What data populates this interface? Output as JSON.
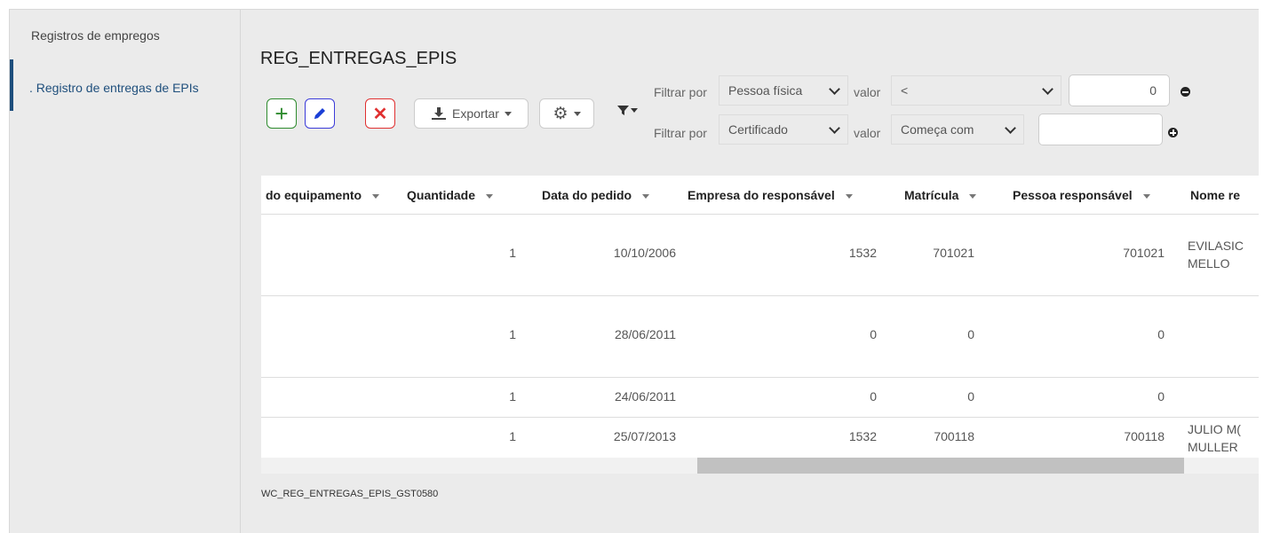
{
  "sidebar": {
    "items": [
      {
        "label": "Registros de empregos"
      },
      {
        "label": ". Registro de entregas de EPIs"
      }
    ]
  },
  "page": {
    "title": "REG_ENTREGAS_EPIS",
    "footer_id": "WC_REG_ENTREGAS_EPIS_GST0580"
  },
  "toolbar": {
    "add_icon": "plus-icon",
    "edit_icon": "pencil-icon",
    "delete_icon": "x-icon",
    "export_label": "Exportar",
    "settings_icon": "gear-icon",
    "filter_icon": "funnel-icon"
  },
  "filters": [
    {
      "label": "Filtrar por",
      "field": "Pessoa física",
      "value_label": "valor",
      "operator": "<",
      "value": "0",
      "action": "remove"
    },
    {
      "label": "Filtrar por",
      "field": "Certificado",
      "value_label": "valor",
      "operator": "Começa com",
      "value": "",
      "action": "add"
    }
  ],
  "table": {
    "columns": [
      "do equipamento",
      "Quantidade",
      "Data do pedido",
      "Empresa do responsável",
      "Matrícula",
      "Pessoa responsável",
      "Nome re"
    ],
    "rows": [
      {
        "equip": "",
        "qtd": "1",
        "data": "10/10/2006",
        "empresa": "1532",
        "matricula": "701021",
        "pessoa": "701021",
        "nome": "EVILASIC MELLO"
      },
      {
        "equip": "",
        "qtd": "1",
        "data": "28/06/2011",
        "empresa": "0",
        "matricula": "0",
        "pessoa": "0",
        "nome": ""
      },
      {
        "equip": "",
        "qtd": "1",
        "data": "24/06/2011",
        "empresa": "0",
        "matricula": "0",
        "pessoa": "0",
        "nome": ""
      },
      {
        "equip": "",
        "qtd": "1",
        "data": "25/07/2013",
        "empresa": "1532",
        "matricula": "700118",
        "pessoa": "700118",
        "nome": "JULIO M( MULLER"
      }
    ]
  },
  "colors": {
    "accent": "#1d4e7c",
    "add": "#2e8b2e",
    "edit": "#3b3bd9",
    "delete": "#e03030"
  }
}
